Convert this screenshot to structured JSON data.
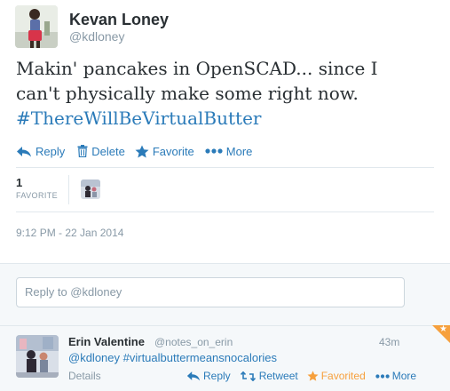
{
  "author": {
    "name": "Kevan Loney",
    "handle": "@kdloney"
  },
  "tweet": {
    "text_line1": "Makin' pancakes in OpenSCAD... since I",
    "text_line2": "can't physically make some right now.",
    "hashtag": "#ThereWillBeVirtualButter"
  },
  "actions": {
    "reply": "Reply",
    "delete": "Delete",
    "favorite": "Favorite",
    "more": "More"
  },
  "stats": {
    "favorite_count": "1",
    "favorite_label": "FAVORITE"
  },
  "timestamp": "9:12 PM - 22 Jan 2014",
  "reply_box": {
    "placeholder": "Reply to @kdloney"
  },
  "reply": {
    "name": "Erin Valentine",
    "handle": "@notes_on_erin",
    "time": "43m",
    "text": "@kdloney #virtualbuttermeansnocalories",
    "details": "Details",
    "actions": {
      "reply": "Reply",
      "retweet": "Retweet",
      "favorited": "Favorited",
      "more": "More"
    }
  },
  "colors": {
    "link_blue": "#2b7bb9",
    "muted_gray": "#8899a6",
    "favorited_orange": "#f6a03d",
    "text_dark": "#292f33"
  }
}
